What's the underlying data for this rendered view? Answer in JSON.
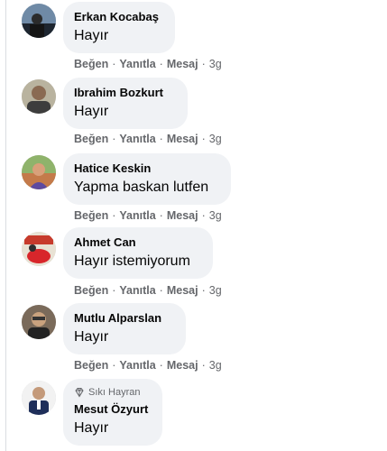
{
  "actions": {
    "like": "Beğen",
    "reply": "Yanıtla",
    "message": "Mesaj",
    "separator": "·"
  },
  "badge_icon": "diamond-icon",
  "comments": [
    {
      "name": "Erkan Kocabaş",
      "text": "Hayır",
      "time": "3g"
    },
    {
      "name": "Ibrahim Bozkurt",
      "text": "Hayır",
      "time": "3g"
    },
    {
      "name": "Hatice Keskin",
      "text": "Yapma baskan lutfen",
      "time": "3g"
    },
    {
      "name": "Ahmet Can",
      "text": "Hayır istemiyorum",
      "time": "3g"
    },
    {
      "name": "Mutlu Alparslan",
      "text": "Hayır",
      "time": "3g"
    },
    {
      "name": "Mesut Özyurt",
      "text": "Hayır",
      "badge": "Sıkı Hayran"
    }
  ],
  "colors": {
    "bubble": "#f0f2f5",
    "meta": "#65676b",
    "text": "#050505"
  }
}
